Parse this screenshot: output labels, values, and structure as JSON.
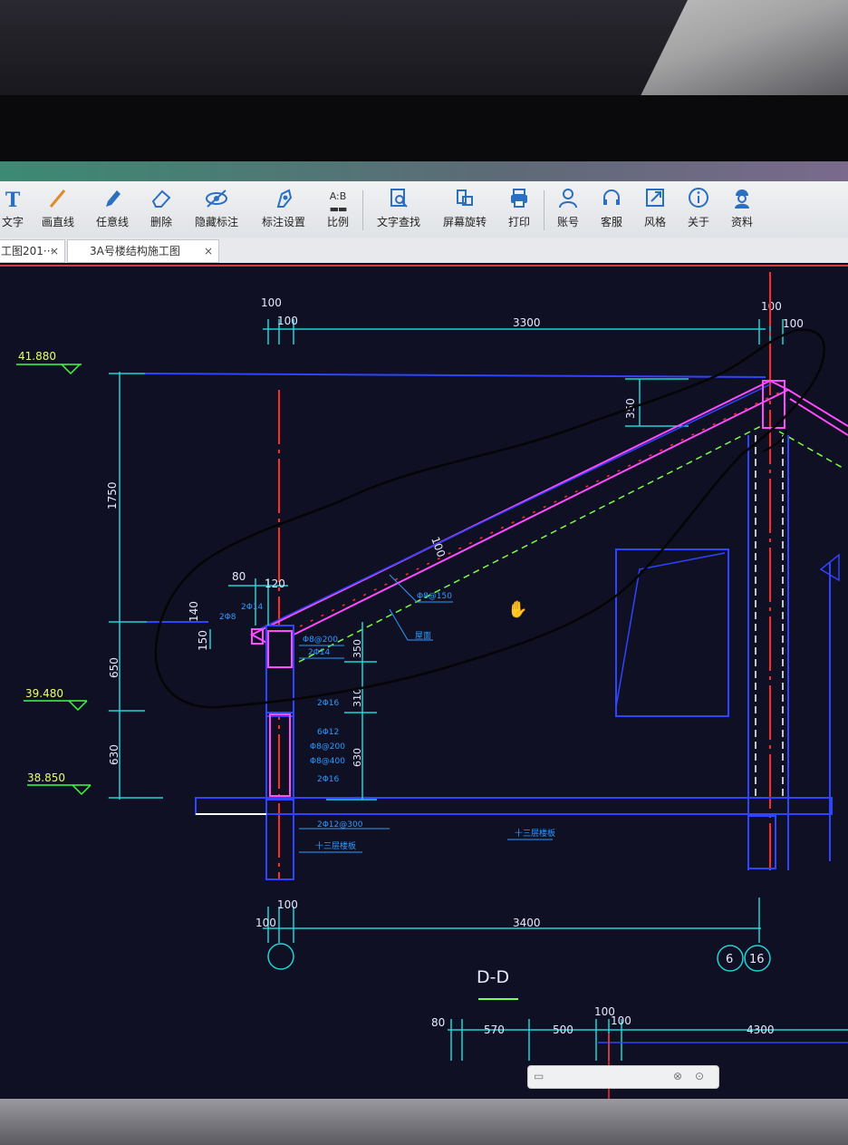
{
  "window": {
    "title_fragment": ""
  },
  "toolbar": {
    "items": [
      {
        "label": "文字",
        "icon": "text-icon"
      },
      {
        "label": "画直线",
        "icon": "line-icon"
      },
      {
        "label": "任意线",
        "icon": "pen-icon"
      },
      {
        "label": "删除",
        "icon": "eraser-icon"
      },
      {
        "label": "隐藏标注",
        "icon": "eye-hide-icon"
      },
      {
        "label": "标注设置",
        "icon": "annotation-settings-icon"
      },
      {
        "label": "比例",
        "icon": "scale-icon"
      },
      {
        "label": "文字查找",
        "icon": "text-search-icon"
      },
      {
        "label": "屏幕旋转",
        "icon": "rotate-screen-icon"
      },
      {
        "label": "打印",
        "icon": "printer-icon"
      },
      {
        "label": "账号",
        "icon": "user-icon"
      },
      {
        "label": "客服",
        "icon": "headset-icon"
      },
      {
        "label": "风格",
        "icon": "style-icon"
      },
      {
        "label": "关于",
        "icon": "info-icon"
      },
      {
        "label": "资料",
        "icon": "worker-icon"
      }
    ]
  },
  "tabs": [
    {
      "label": "工图201···",
      "close": "×"
    },
    {
      "label": "3A号楼结构施工图",
      "close": "×"
    }
  ],
  "drawing": {
    "section_title": "D-D",
    "elevations": [
      "41.880",
      "39.480",
      "38.850"
    ],
    "dims_top": [
      "100",
      "100",
      "3300",
      "100",
      "100"
    ],
    "dims_left": [
      "1750",
      "650",
      "630"
    ],
    "dims_right": [
      "350",
      "350",
      "310",
      "630"
    ],
    "dims_bottom": [
      "100",
      "100",
      "3400"
    ],
    "dims_lower": [
      "80",
      "570",
      "500",
      "100",
      "100",
      "4300"
    ],
    "small_dims": [
      "80",
      "120",
      "140",
      "150",
      "100"
    ],
    "axis_labels": [
      "6",
      "16"
    ],
    "rebar_notes": [
      "2Φ14",
      "2Φ8",
      "Φ8@200",
      "2Φ14",
      "Φ8@150",
      "2Φ16",
      "6Φ12",
      "Φ8@200",
      "Φ8@400",
      "2Φ16",
      "2Φ12@300",
      "屋面",
      "十三层楼板",
      "十三层楼板"
    ]
  },
  "colors": {
    "screen_bg": "#0f1024",
    "dimension": "#1fd6d6",
    "wall": "#2e44ff",
    "axis": "#ff2b2b",
    "slab_line": "#ff4cff",
    "dash": "#7dff45",
    "elevation": "#3cff3c",
    "ink": "#050505"
  }
}
